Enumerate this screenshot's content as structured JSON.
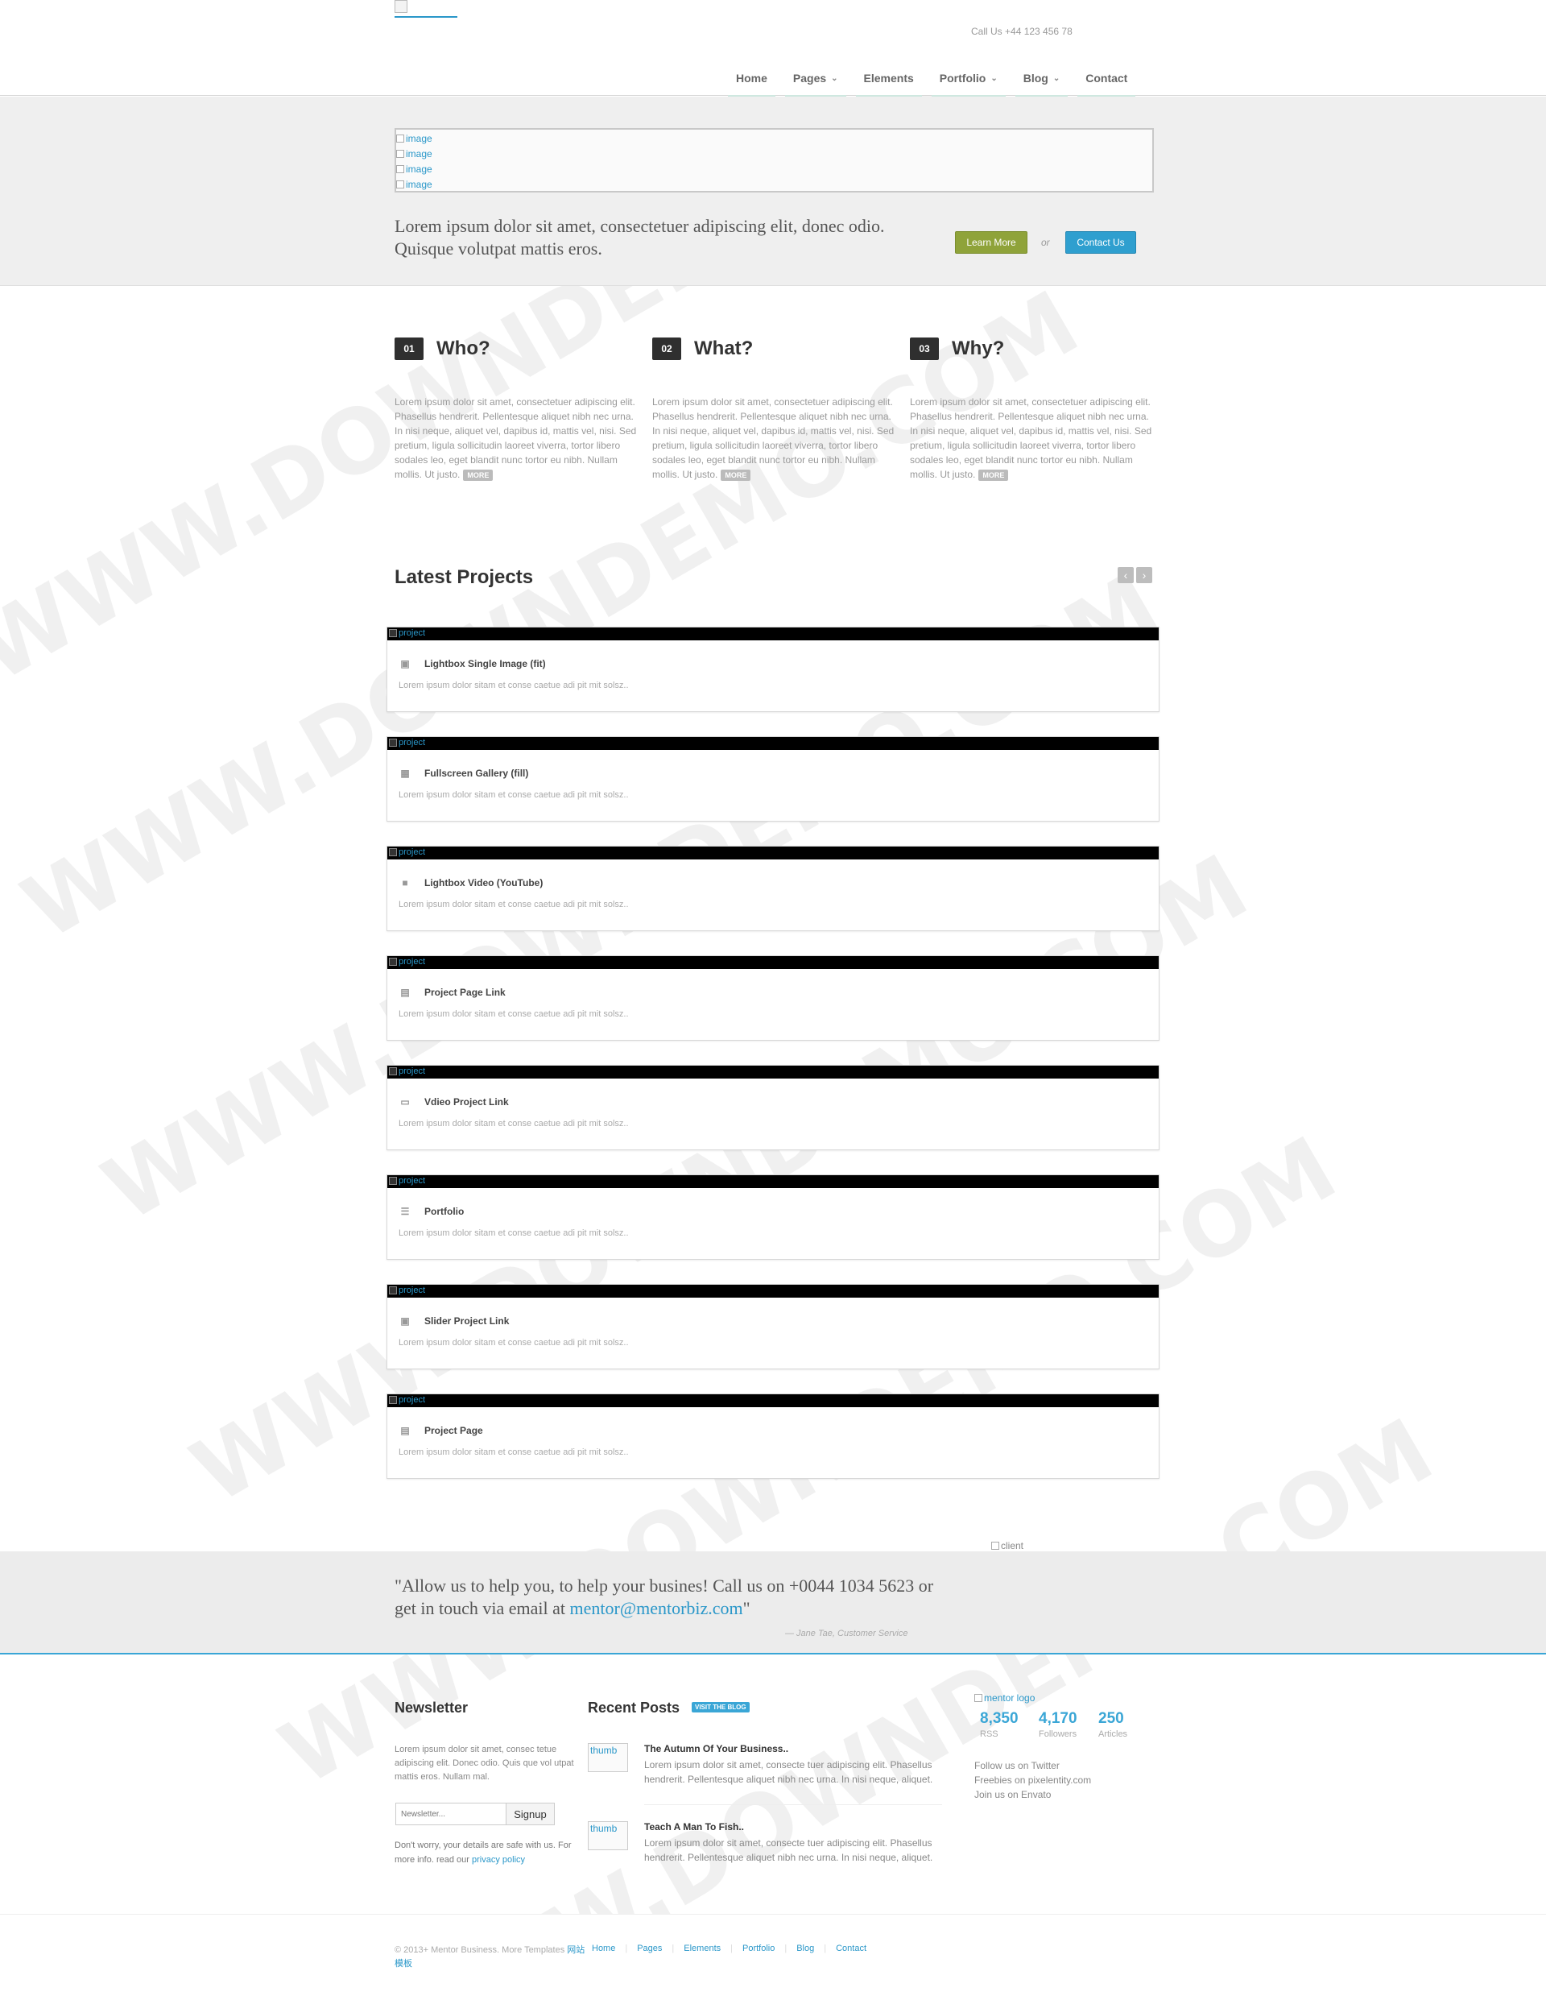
{
  "header": {
    "call_us": "Call Us +44 123 456 78",
    "nav": [
      {
        "label": "Home",
        "has_dropdown": false
      },
      {
        "label": "Pages",
        "has_dropdown": true
      },
      {
        "label": "Elements",
        "has_dropdown": false
      },
      {
        "label": "Portfolio",
        "has_dropdown": true
      },
      {
        "label": "Blog",
        "has_dropdown": true
      },
      {
        "label": "Contact",
        "has_dropdown": false
      }
    ]
  },
  "hero": {
    "slides": [
      "image",
      "image",
      "image",
      "image"
    ],
    "text": "Lorem ipsum dolor sit amet, consectetuer adipiscing elit, donec odio. Quisque volutpat mattis eros.",
    "learn_more": "Learn More",
    "or": "or",
    "contact_us": "Contact Us"
  },
  "features": [
    {
      "num": "01",
      "title": "Who?",
      "text": "Lorem ipsum dolor sit amet, consectetuer adipiscing elit. Phasellus hendrerit. Pellentesque aliquet nibh nec urna. In nisi neque, aliquet vel, dapibus id, mattis vel, nisi. Sed pretium, ligula sollicitudin laoreet viverra, tortor libero sodales leo, eget blandit nunc tortor eu nibh. Nullam mollis. Ut justo.",
      "more": "MORE"
    },
    {
      "num": "02",
      "title": "What?",
      "text": "Lorem ipsum dolor sit amet, consectetuer adipiscing elit. Phasellus hendrerit. Pellentesque aliquet nibh nec urna. In nisi neque, aliquet vel, dapibus id, mattis vel, nisi. Sed pretium, ligula sollicitudin laoreet viverra, tortor libero sodales leo, eget blandit nunc tortor eu nibh. Nullam mollis. Ut justo.",
      "more": "MORE"
    },
    {
      "num": "03",
      "title": "Why?",
      "text": "Lorem ipsum dolor sit amet, consectetuer adipiscing elit. Phasellus hendrerit. Pellentesque aliquet nibh nec urna. In nisi neque, aliquet vel, dapibus id, mattis vel, nisi. Sed pretium, ligula sollicitudin laoreet viverra, tortor libero sodales leo, eget blandit nunc tortor eu nibh. Nullam mollis. Ut justo.",
      "more": "MORE"
    }
  ],
  "latest_projects": {
    "title": "Latest Projects",
    "prev": "‹",
    "next": "›",
    "items": [
      {
        "img_alt": "project",
        "icon": "image-icon",
        "glyph": "▣",
        "title": "Lightbox Single Image (fit)",
        "desc": "Lorem ipsum dolor sitam et conse caetue adi pit mit solsz.."
      },
      {
        "img_alt": "project",
        "icon": "grid-icon",
        "glyph": "▦",
        "title": "Fullscreen Gallery (fill)",
        "desc": "Lorem ipsum dolor sitam et conse caetue adi pit mit solsz.."
      },
      {
        "img_alt": "project",
        "icon": "video-icon",
        "glyph": "■",
        "title": "Lightbox Video (YouTube)",
        "desc": "Lorem ipsum dolor sitam et conse caetue adi pit mit solsz.."
      },
      {
        "img_alt": "project",
        "icon": "document-icon",
        "glyph": "▤",
        "title": "Project Page Link",
        "desc": "Lorem ipsum dolor sitam et conse caetue adi pit mit solsz.."
      },
      {
        "img_alt": "project",
        "icon": "film-icon",
        "glyph": "▭",
        "title": "Vdieo Project Link",
        "desc": "Lorem ipsum dolor sitam et conse caetue adi pit mit solsz.."
      },
      {
        "img_alt": "project",
        "icon": "list-icon",
        "glyph": "☰",
        "title": "Portfolio",
        "desc": "Lorem ipsum dolor sitam et conse caetue adi pit mit solsz.."
      },
      {
        "img_alt": "project",
        "icon": "image-icon",
        "glyph": "▣",
        "title": "Slider Project Link",
        "desc": "Lorem ipsum dolor sitam et conse caetue adi pit mit solsz.."
      },
      {
        "img_alt": "project",
        "icon": "document-icon",
        "glyph": "▤",
        "title": "Project Page",
        "desc": "Lorem ipsum dolor sitam et conse caetue adi pit mit solsz.."
      }
    ]
  },
  "quote": {
    "client_alt": "client",
    "text": "\"Allow us to help you, to help your busines! Call us on +0044 1034 5623 or get in touch via email at ",
    "email": "mentor@mentorbiz.com",
    "close": "\"",
    "cite": "— Jane Tae, Customer Service"
  },
  "newsletter": {
    "title": "Newsletter",
    "text": "Lorem ipsum dolor sit amet, consec tetue adipiscing elit. Donec odio. Quis que vol utpat mattis eros. Nullam mal.",
    "placeholder": "Newsletter...",
    "signup": "Signup",
    "note": "Don't worry, your details are safe with us. For more info. read our ",
    "privacy": "privacy policy"
  },
  "recent_posts": {
    "title": "Recent Posts",
    "badge": "VISIT THE BLOG",
    "posts": [
      {
        "thumb": "thumb",
        "title": "The Autumn Of Your Business..",
        "text": "Lorem ipsum dolor sit amet, consecte tuer adipiscing elit. Phasellus hendrerit. Pellentesque aliquet nibh nec urna. In nisi neque, aliquet."
      },
      {
        "thumb": "thumb",
        "title": "Teach A Man To Fish..",
        "text": "Lorem ipsum dolor sit amet, consecte tuer adipiscing elit. Phasellus hendrerit. Pellentesque aliquet nibh nec urna. In nisi neque, aliquet."
      }
    ]
  },
  "social": {
    "logo_alt": "mentor logo",
    "stats": [
      {
        "value": "8,350",
        "label": "RSS"
      },
      {
        "value": "4,170",
        "label": "Followers"
      },
      {
        "value": "250",
        "label": "Articles"
      }
    ],
    "links": [
      "Follow us on Twitter",
      "Freebies on pixelentity.com",
      "Join us on Envato"
    ]
  },
  "footer": {
    "copyright": "© 2013+ Mentor Business. More Templates ",
    "copyright_link": "网站模板",
    "nav": [
      "Home",
      "Pages",
      "Elements",
      "Portfolio",
      "Blog",
      "Contact"
    ]
  },
  "watermark": "WWW.DOWNDEMO.COM",
  "colors": {
    "accent": "#2a97c9",
    "learn_more": "#8fa33a",
    "contact": "#2f9fcf",
    "dark_badge": "#2f2f2f"
  }
}
